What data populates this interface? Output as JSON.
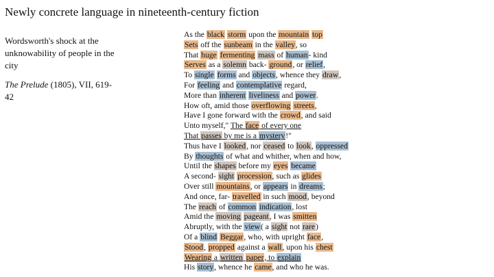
{
  "title": "Newly concrete language in nineteenth-century fiction",
  "caption": {
    "description": "Wordsworth's shock at the unknowability of people in the city",
    "source_work": "The Prelude",
    "source_detail": " (1805), VII, 619-42"
  },
  "highlight_colors": {
    "o": "#e8b98c",
    "b": "#a9bfd2",
    "g": "#cfc5bd"
  },
  "poem": [
    [
      [
        "As the ",
        ""
      ],
      [
        "black",
        "o"
      ],
      [
        " ",
        ""
      ],
      [
        "storm",
        "o"
      ],
      [
        " upon the ",
        ""
      ],
      [
        "mountain",
        "o"
      ],
      [
        " ",
        ""
      ],
      [
        "top",
        "o"
      ]
    ],
    [
      [
        "Sets",
        "o"
      ],
      [
        " off the ",
        ""
      ],
      [
        "sunbeam",
        "o"
      ],
      [
        " in the ",
        ""
      ],
      [
        "valley",
        "o"
      ],
      [
        ", so",
        ""
      ]
    ],
    [
      [
        "That ",
        ""
      ],
      [
        "huge",
        "o"
      ],
      [
        " ",
        ""
      ],
      [
        "fermenting",
        "o"
      ],
      [
        " ",
        ""
      ],
      [
        "mass",
        "g"
      ],
      [
        " of ",
        ""
      ],
      [
        "human",
        "b"
      ],
      [
        "- kind",
        ""
      ]
    ],
    [
      [
        "Serves",
        "o"
      ],
      [
        " as a ",
        ""
      ],
      [
        "solemn",
        "g"
      ],
      [
        " back- ",
        ""
      ],
      [
        "ground",
        "o"
      ],
      [
        ", or ",
        ""
      ],
      [
        "relief",
        "b"
      ],
      [
        ",",
        ""
      ]
    ],
    [
      [
        "To ",
        ""
      ],
      [
        "single",
        "b"
      ],
      [
        " ",
        ""
      ],
      [
        "forms",
        "b"
      ],
      [
        " and ",
        ""
      ],
      [
        "objects",
        "b"
      ],
      [
        ", whence they ",
        ""
      ],
      [
        "draw",
        "g"
      ],
      [
        ",",
        ""
      ]
    ],
    [
      [
        "For ",
        ""
      ],
      [
        "feeling",
        "b"
      ],
      [
        " and ",
        ""
      ],
      [
        "contemplative",
        "b"
      ],
      [
        " regard,",
        ""
      ]
    ],
    [
      [
        "More than ",
        ""
      ],
      [
        "inherent",
        "b"
      ],
      [
        " ",
        ""
      ],
      [
        "liveliness",
        "b"
      ],
      [
        " and ",
        ""
      ],
      [
        "power",
        "b"
      ],
      [
        ".",
        ""
      ]
    ],
    [
      [
        "How oft, amid those ",
        ""
      ],
      [
        "overflowing",
        "o"
      ],
      [
        " ",
        ""
      ],
      [
        "streets",
        "o"
      ],
      [
        ",",
        ""
      ]
    ],
    [
      [
        "Have I gone forward with the ",
        ""
      ],
      [
        "crowd",
        "o"
      ],
      [
        ", and said",
        ""
      ]
    ],
    [
      [
        "Unto myself,\" ",
        ""
      ],
      [
        "The ",
        "u"
      ],
      [
        "face",
        "o u"
      ],
      [
        " of every one",
        "u"
      ]
    ],
    [
      [
        "That ",
        "u"
      ],
      [
        "passes",
        "g u"
      ],
      [
        " by me is a ",
        "u"
      ],
      [
        "mystery",
        "b u"
      ],
      [
        "!\"",
        ""
      ]
    ],
    [
      [
        "Thus have I ",
        ""
      ],
      [
        "looked",
        "g"
      ],
      [
        ", nor ",
        ""
      ],
      [
        "ceased",
        "g"
      ],
      [
        " to ",
        ""
      ],
      [
        "look",
        "g"
      ],
      [
        ", ",
        ""
      ],
      [
        "oppressed",
        "b"
      ]
    ],
    [
      [
        "By ",
        ""
      ],
      [
        "thoughts",
        "b"
      ],
      [
        " of what and whither, when and how,",
        ""
      ]
    ],
    [
      [
        "Until the ",
        ""
      ],
      [
        "shapes",
        "g"
      ],
      [
        " before my ",
        ""
      ],
      [
        "eyes",
        "o"
      ],
      [
        " ",
        ""
      ],
      [
        "became",
        "b"
      ]
    ],
    [
      [
        "A second- ",
        ""
      ],
      [
        "sight",
        "g"
      ],
      [
        " ",
        ""
      ],
      [
        "procession",
        "o"
      ],
      [
        ", such as ",
        ""
      ],
      [
        "glides",
        "o"
      ]
    ],
    [
      [
        "Over still ",
        ""
      ],
      [
        "mountains",
        "o"
      ],
      [
        ", or ",
        ""
      ],
      [
        "appears",
        "b"
      ],
      [
        " in ",
        ""
      ],
      [
        "dreams",
        "b"
      ],
      [
        ";",
        ""
      ]
    ],
    [
      [
        "And once, far- ",
        ""
      ],
      [
        "travelled",
        "o"
      ],
      [
        " in such ",
        ""
      ],
      [
        "mood",
        "g"
      ],
      [
        ", beyond",
        ""
      ]
    ],
    [
      [
        "The ",
        ""
      ],
      [
        "reach",
        "g"
      ],
      [
        " of ",
        ""
      ],
      [
        "common",
        "b"
      ],
      [
        " ",
        ""
      ],
      [
        "indication",
        "b"
      ],
      [
        ", lost",
        ""
      ]
    ],
    [
      [
        "Amid the ",
        ""
      ],
      [
        "moving",
        "g"
      ],
      [
        " ",
        ""
      ],
      [
        "pageant",
        "g"
      ],
      [
        ", I was ",
        ""
      ],
      [
        "smitten",
        "o"
      ]
    ],
    [
      [
        "Abruptly, with the ",
        ""
      ],
      [
        "view",
        "b"
      ],
      [
        "( a ",
        ""
      ],
      [
        "sight",
        "g"
      ],
      [
        " not ",
        ""
      ],
      [
        "rare",
        "g"
      ],
      [
        ")",
        ""
      ]
    ],
    [
      [
        "Of a ",
        ""
      ],
      [
        "blind",
        "b"
      ],
      [
        " ",
        ""
      ],
      [
        "Beggar",
        "o"
      ],
      [
        ", who, with upright ",
        ""
      ],
      [
        "face",
        "o"
      ],
      [
        ",",
        ""
      ]
    ],
    [
      [
        "Stood",
        "o"
      ],
      [
        ", ",
        ""
      ],
      [
        "propped",
        "o"
      ],
      [
        " against a ",
        ""
      ],
      [
        "wall",
        "o"
      ],
      [
        ", upon his ",
        ""
      ],
      [
        "chest",
        "o"
      ]
    ],
    [
      [
        "Wearing",
        "o u"
      ],
      [
        " a ",
        "u"
      ],
      [
        "written",
        "g u"
      ],
      [
        " ",
        "u"
      ],
      [
        "paper",
        "o u"
      ],
      [
        ", to ",
        "u"
      ],
      [
        "explain",
        "b u"
      ]
    ],
    [
      [
        "His ",
        ""
      ],
      [
        "story",
        "b"
      ],
      [
        ", whence he ",
        ""
      ],
      [
        "came",
        "o"
      ],
      [
        ", and who he was.",
        ""
      ]
    ]
  ]
}
